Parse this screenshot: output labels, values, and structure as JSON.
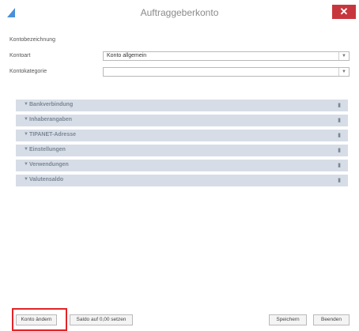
{
  "window": {
    "title": "Auftraggeberkonto",
    "close_label": "✕",
    "app_icon": "arrow-icon"
  },
  "form": {
    "kontobezeichnung_label": "Kontobezeichnung",
    "kontoart_label": "Kontoart",
    "kontoart_value": "Konto allgemein",
    "kontokategorie_label": "Kontokategorie",
    "kontokategorie_value": ""
  },
  "sections": [
    {
      "label": "Bankverbindung"
    },
    {
      "label": "Inhaberangaben"
    },
    {
      "label": "TIPANET-Adresse"
    },
    {
      "label": "Einstellungen"
    },
    {
      "label": "Verwendungen"
    },
    {
      "label": "Valutensaldo"
    }
  ],
  "buttons": {
    "konto_aendern": "Konto ändern",
    "saldo_reset": "Saldo auf 0,00 setzen",
    "speichern": "Speichern",
    "beenden": "Beenden"
  },
  "colors": {
    "close": "#c8363d",
    "section_bg": "#d6dde6",
    "highlight": "#e32428"
  }
}
